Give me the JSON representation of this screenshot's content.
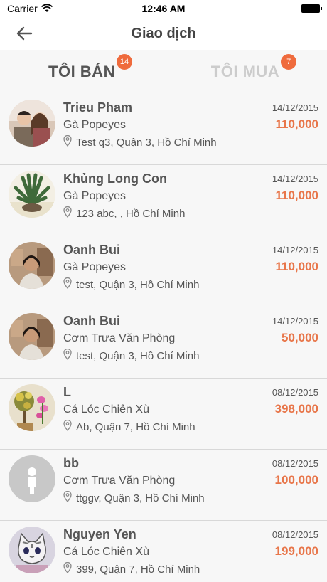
{
  "status_bar": {
    "carrier": "Carrier",
    "time": "12:46 AM"
  },
  "nav": {
    "title": "Giao dịch"
  },
  "tabs": [
    {
      "label": "TÔI BÁN",
      "badge": "14",
      "active": true
    },
    {
      "label": "TÔI MUA",
      "badge": "7",
      "active": false
    }
  ],
  "colors": {
    "accent": "#ef6b3d",
    "price": "#e8764a"
  },
  "transactions": [
    {
      "name": "Trieu Pham",
      "product": "Gà Popeyes",
      "address": "Test q3, Quận 3, Hồ Chí Minh",
      "date": "14/12/2015",
      "price": "110,000",
      "avatar": "couple-photo"
    },
    {
      "name": "Khủng Long Con",
      "product": "Gà Popeyes",
      "address": "123 abc, , Hồ Chí Minh",
      "date": "14/12/2015",
      "price": "110,000",
      "avatar": "plant-photo"
    },
    {
      "name": "Oanh Bui",
      "product": "Gà Popeyes",
      "address": "test, Quận 3, Hồ Chí Minh",
      "date": "14/12/2015",
      "price": "110,000",
      "avatar": "woman-photo"
    },
    {
      "name": "Oanh Bui",
      "product": "Cơm Trưa Văn Phòng",
      "address": "test, Quận 3, Hồ Chí Minh",
      "date": "14/12/2015",
      "price": "50,000",
      "avatar": "woman-photo"
    },
    {
      "name": "L",
      "product": "Cá Lóc Chiên Xù",
      "address": "Ab, Quận 7, Hồ Chí Minh",
      "date": "08/12/2015",
      "price": "398,000",
      "avatar": "flowers-photo"
    },
    {
      "name": "bb",
      "product": "Cơm Trưa Văn Phòng",
      "address": "ttggv, Quận 3, Hồ Chí Minh",
      "date": "08/12/2015",
      "price": "100,000",
      "avatar": "default-person"
    },
    {
      "name": "Nguyen Yen",
      "product": "Cá Lóc Chiên Xù",
      "address": "399, Quận 7, Hồ Chí Minh",
      "date": "08/12/2015",
      "price": "199,000",
      "avatar": "cat-cartoon"
    }
  ]
}
